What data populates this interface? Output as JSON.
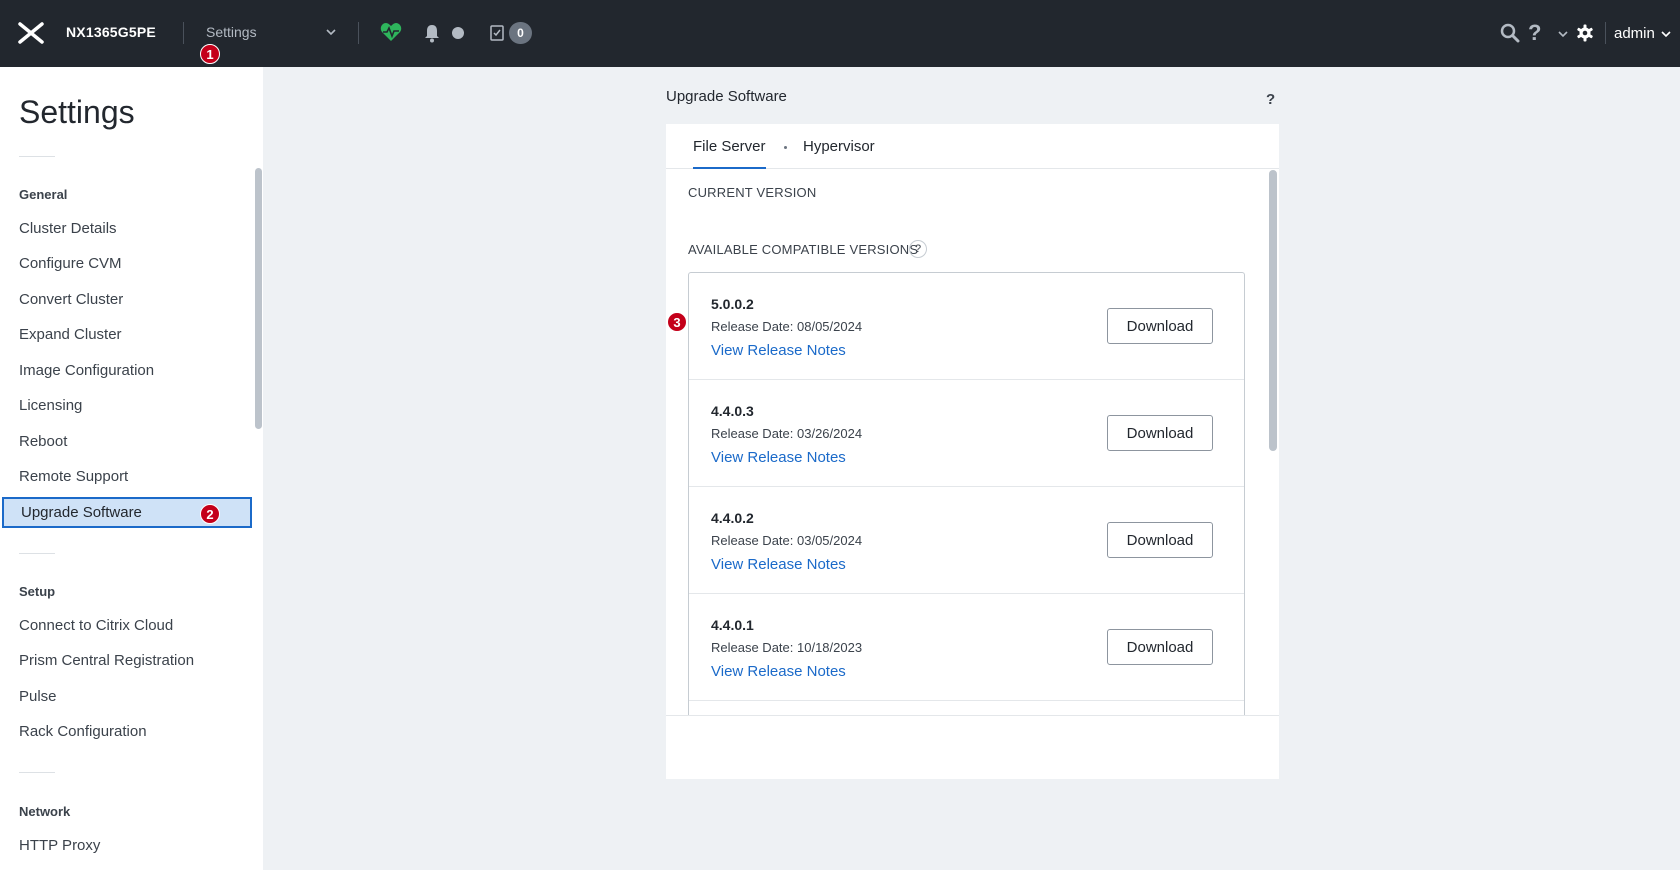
{
  "topbar": {
    "cluster_name": "NX1365G5PE",
    "menu_label": "Settings",
    "task_count": "0",
    "user": "admin",
    "help_glyph": "?",
    "icons": [
      "nutanix-logo-icon",
      "chevron-down-icon",
      "health-heart-icon",
      "bell-icon",
      "alert-dot-icon",
      "task-icon",
      "search-icon",
      "help-icon",
      "gear-icon"
    ]
  },
  "annotations": {
    "step1": "1",
    "step2": "2",
    "step3": "3"
  },
  "sidebar": {
    "title": "Settings",
    "sections": [
      {
        "label": "General",
        "items": [
          "Cluster Details",
          "Configure CVM",
          "Convert Cluster",
          "Expand Cluster",
          "Image Configuration",
          "Licensing",
          "Reboot",
          "Remote Support",
          "Upgrade Software"
        ]
      },
      {
        "label": "Setup",
        "items": [
          "Connect to Citrix Cloud",
          "Prism Central Registration",
          "Pulse",
          "Rack Configuration"
        ]
      },
      {
        "label": "Network",
        "items": [
          "HTTP Proxy"
        ]
      }
    ],
    "active_item": "Upgrade Software"
  },
  "main": {
    "title": "Upgrade Software",
    "help": "?",
    "tabs": [
      {
        "label": "File Server",
        "active": true
      },
      {
        "label": "Hypervisor",
        "active": false
      }
    ],
    "current_version_label": "CURRENT VERSION",
    "available_label": "AVAILABLE COMPATIBLE VERSIONS",
    "available_help": "?",
    "versions": [
      {
        "version": "5.0.0.2",
        "release": "Release Date: 08/05/2024",
        "notes": "View Release Notes",
        "button": "Download"
      },
      {
        "version": "4.4.0.3",
        "release": "Release Date: 03/26/2024",
        "notes": "View Release Notes",
        "button": "Download"
      },
      {
        "version": "4.4.0.2",
        "release": "Release Date: 03/05/2024",
        "notes": "View Release Notes",
        "button": "Download"
      },
      {
        "version": "4.4.0.1",
        "release": "Release Date: 10/18/2023",
        "notes": "View Release Notes",
        "button": "Download"
      }
    ]
  },
  "colors": {
    "topbar": "#22272e",
    "accent": "#1b6ac9",
    "active_bg": "#cfe2f7",
    "annotation": "#c4001a",
    "health": "#2eb55c"
  }
}
